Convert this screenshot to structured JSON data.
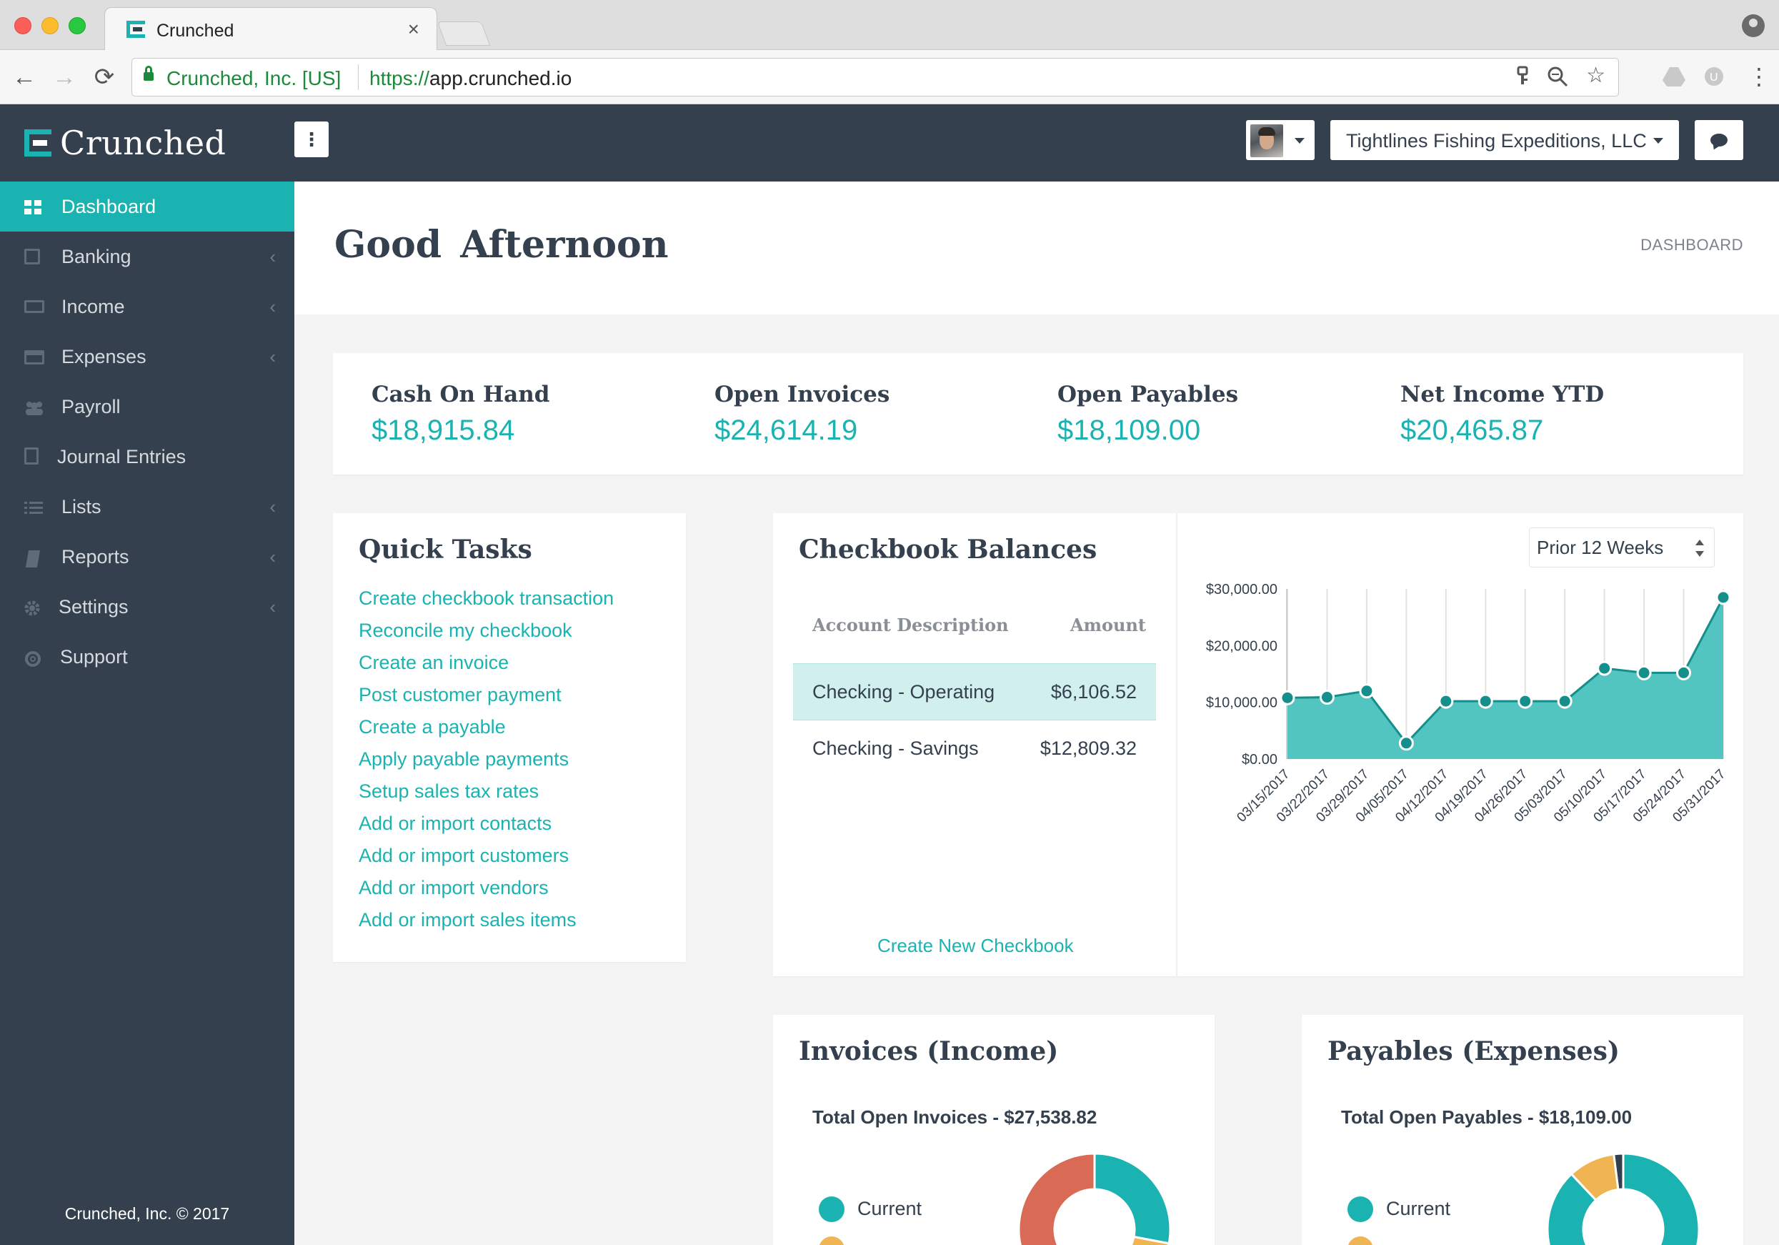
{
  "browser": {
    "tab_title": "Crunched",
    "tab_close": "×",
    "origin": "Crunched, Inc. [US]",
    "url_scheme": "https://",
    "url_host": "app.crunched.io",
    "nav": {
      "back": "←",
      "forward": "→",
      "reload": "⟳"
    },
    "icons": [
      "key-icon",
      "zoom-icon",
      "star-icon",
      "drive-icon",
      "extension-icon",
      "menu-icon"
    ]
  },
  "header": {
    "logo_text": "Crunched",
    "menu_toggle": "⋮",
    "company_name": "Tightlines Fishing Expeditions, LLC"
  },
  "sidebar": {
    "items": [
      {
        "label": "Dashboard",
        "icon": "dashboard-icon",
        "chevron": "",
        "active": true
      },
      {
        "label": "Banking",
        "icon": "banking-icon",
        "chevron": "‹"
      },
      {
        "label": "Income",
        "icon": "income-icon",
        "chevron": "‹"
      },
      {
        "label": "Expenses",
        "icon": "expenses-icon",
        "chevron": "‹"
      },
      {
        "label": "Payroll",
        "icon": "payroll-icon",
        "chevron": ""
      },
      {
        "label": "Journal Entries",
        "icon": "journal-icon",
        "chevron": ""
      },
      {
        "label": "Lists",
        "icon": "lists-icon",
        "chevron": "‹"
      },
      {
        "label": "Reports",
        "icon": "reports-icon",
        "chevron": "‹"
      },
      {
        "label": "Settings",
        "icon": "settings-icon",
        "chevron": "‹"
      },
      {
        "label": "Support",
        "icon": "support-icon",
        "chevron": ""
      }
    ],
    "footer": "Crunched, Inc. © 2017"
  },
  "page": {
    "greeting": "Good Afternoon",
    "breadcrumb": "DASHBOARD"
  },
  "kpis": [
    {
      "label": "Cash On Hand",
      "value": "$18,915.84"
    },
    {
      "label": "Open Invoices",
      "value": "$24,614.19"
    },
    {
      "label": "Open Payables",
      "value": "$18,109.00"
    },
    {
      "label": "Net Income YTD",
      "value": "$20,465.87"
    }
  ],
  "quick_tasks": {
    "title": "Quick Tasks",
    "links": [
      "Create checkbook transaction",
      "Reconcile my checkbook",
      "Create an invoice",
      "Post customer payment",
      "Create a payable",
      "Apply payable payments",
      "Setup sales tax rates",
      "Add or import contacts",
      "Add or import customers",
      "Add or import vendors",
      "Add or import sales items"
    ]
  },
  "checkbook": {
    "title": "Checkbook Balances",
    "col_desc": "Account Description",
    "col_amount": "Amount",
    "rows": [
      {
        "desc": "Checking - Operating",
        "amount": "$6,106.52"
      },
      {
        "desc": "Checking - Savings",
        "amount": "$12,809.32"
      }
    ],
    "create_link": "Create New Checkbook",
    "period": "Prior 12 Weeks"
  },
  "chart_data": {
    "type": "area",
    "x": [
      "03/15/2017",
      "03/22/2017",
      "03/29/2017",
      "04/05/2017",
      "04/12/2017",
      "04/19/2017",
      "04/26/2017",
      "05/03/2017",
      "05/10/2017",
      "05/17/2017",
      "05/24/2017",
      "05/31/2017"
    ],
    "y_tick_labels": [
      "$0.00",
      "$10,000.00",
      "$20,000.00",
      "$30,000.00"
    ],
    "y_ticks": [
      0,
      10000,
      20000,
      30000
    ],
    "ylim": [
      0,
      30000
    ],
    "series": [
      {
        "values": [
          10800,
          10900,
          12000,
          2800,
          10200,
          10200,
          10200,
          10200,
          16000,
          15200,
          15200,
          28500
        ]
      }
    ],
    "fill_color": "#52c5c0",
    "line_color": "#148f8b",
    "grid": "vertical"
  },
  "invoices": {
    "title": "Invoices (Income)",
    "total": "Total Open Invoices - $27,538.82",
    "legend": [
      {
        "label": "Current",
        "color": "#1ab3b1"
      }
    ],
    "donut": [
      {
        "value": 28,
        "color": "#1ab3b1"
      },
      {
        "value": 12,
        "color": "#f0b552"
      },
      {
        "value": 60,
        "color": "#d96a55"
      }
    ]
  },
  "payables": {
    "title": "Payables (Expenses)",
    "total": "Total Open Payables - $18,109.00",
    "legend": [
      {
        "label": "Current",
        "color": "#1ab3b1"
      }
    ],
    "donut": [
      {
        "value": 88,
        "color": "#1ab3b1"
      },
      {
        "value": 10,
        "color": "#f0b552"
      },
      {
        "value": 2,
        "color": "#34404e"
      }
    ]
  }
}
